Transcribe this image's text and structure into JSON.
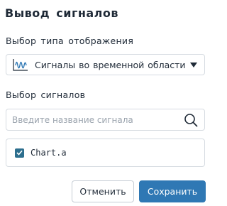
{
  "dialog": {
    "title": "Вывод сигналов"
  },
  "display_type": {
    "label": "Выбор типа отображения",
    "selected": "Сигналы во временной области",
    "icon": "waveform-icon"
  },
  "signals": {
    "label": "Выбор сигналов",
    "search_placeholder": "Введите название сигнала",
    "search_value": "",
    "items": [
      {
        "name": "Chart.a",
        "checked": true
      }
    ]
  },
  "buttons": {
    "cancel": "Отменить",
    "save": "Сохранить"
  },
  "colors": {
    "primary": "#2f78b4",
    "checkbox": "#2d6f8e",
    "border": "#d6dbe1"
  }
}
